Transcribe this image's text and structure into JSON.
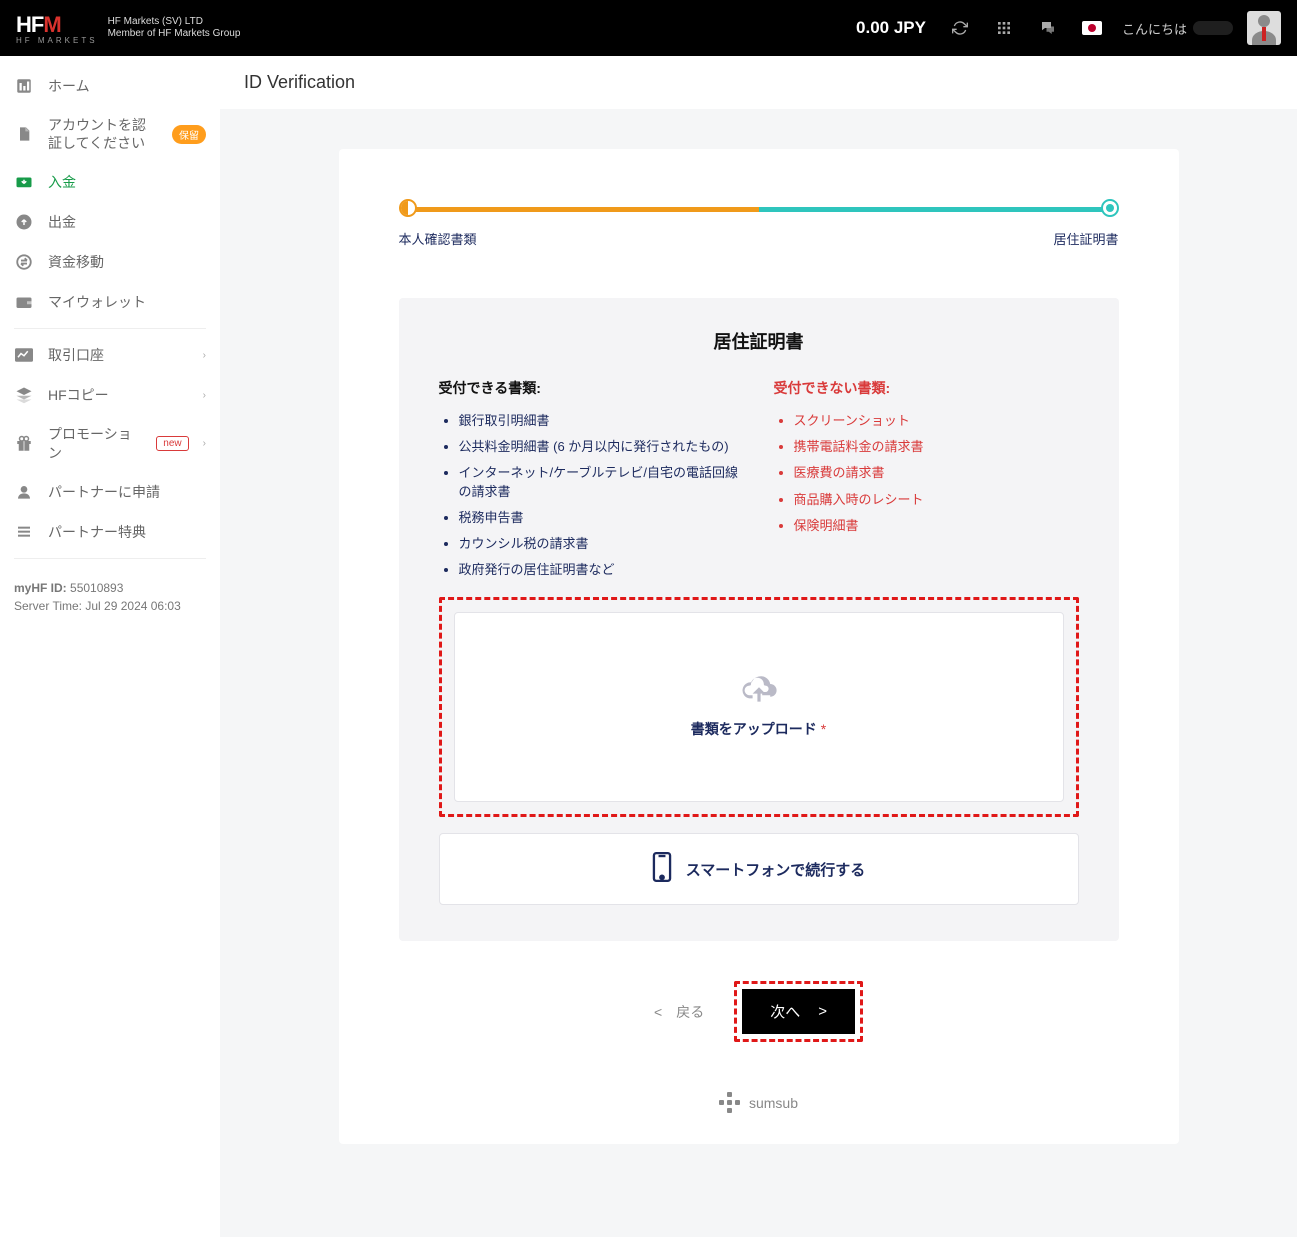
{
  "header": {
    "company_line1": "HF Markets (SV) LTD",
    "company_line2": "Member of HF Markets Group",
    "balance": "0.00 JPY",
    "greeting": "こんにちは"
  },
  "sidebar": {
    "items": [
      {
        "label": "ホーム"
      },
      {
        "label": "アカウントを認証してください",
        "badge": "保留"
      },
      {
        "label": "入金",
        "active": true
      },
      {
        "label": "出金"
      },
      {
        "label": "資金移動"
      },
      {
        "label": "マイウォレット"
      }
    ],
    "group2": [
      {
        "label": "取引口座",
        "chevron": true
      },
      {
        "label": "HFコピー",
        "chevron": true
      },
      {
        "label": "プロモーション",
        "new_badge": "new",
        "chevron": true
      },
      {
        "label": "パートナーに申請"
      },
      {
        "label": "パートナー特典"
      }
    ],
    "footer": {
      "id_label": "myHF ID:",
      "id_value": "55010893",
      "server_label": "Server Time:",
      "server_value": "Jul 29 2024 06:03"
    }
  },
  "page": {
    "title": "ID Verification",
    "step1_label": "本人確認書類",
    "step2_label": "居住証明書",
    "panel_title": "居住証明書",
    "accept_title": "受付できる書類:",
    "reject_title": "受付できない書類:",
    "accept_list": [
      "銀行取引明細書",
      "公共料金明細書 (6 か月以内に発行されたもの)",
      "インターネット/ケーブルテレビ/自宅の電話回線の請求書",
      "税務申告書",
      "カウンシル税の請求書",
      "政府発行の居住証明書など"
    ],
    "reject_list": [
      "スクリーンショット",
      "携帯電話料金の請求書",
      "医療費の請求書",
      "商品購入時のレシート",
      "保険明細書"
    ],
    "upload_label": "書類をアップロード",
    "phone_label": "スマートフォンで続行する",
    "back_label": "戻る",
    "next_label": "次へ",
    "sumsub": "sumsub"
  }
}
